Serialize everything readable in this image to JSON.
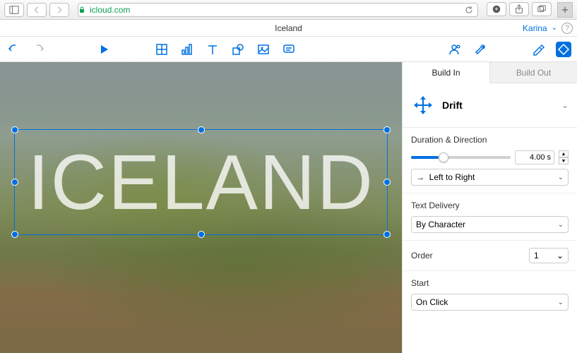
{
  "browser": {
    "url": "icloud.com"
  },
  "doc": {
    "title": "Iceland",
    "user": "Karina"
  },
  "canvas": {
    "text": "ICELAND"
  },
  "inspector": {
    "tabs": {
      "build_in": "Build In",
      "build_out": "Build Out"
    },
    "effect": {
      "name": "Drift"
    },
    "duration": {
      "label": "Duration & Direction",
      "value": "4.00 s",
      "direction": "Left to Right"
    },
    "delivery": {
      "label": "Text Delivery",
      "value": "By Character"
    },
    "order": {
      "label": "Order",
      "value": "1"
    },
    "start": {
      "label": "Start",
      "value": "On Click"
    }
  }
}
